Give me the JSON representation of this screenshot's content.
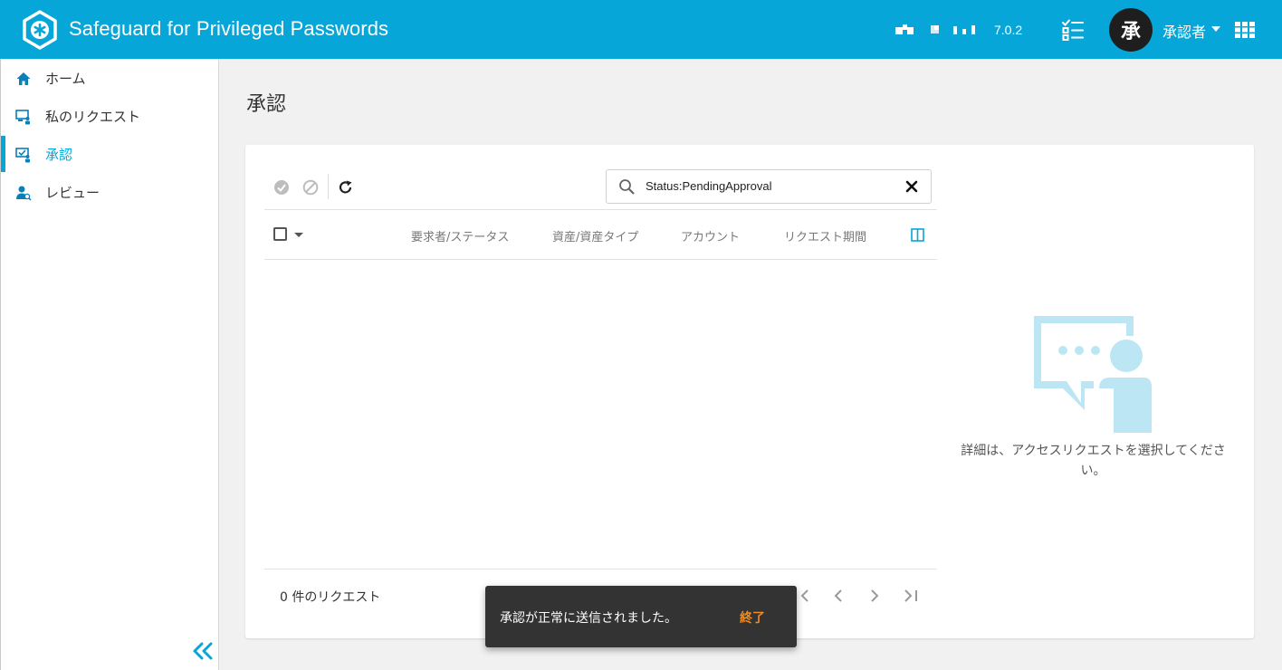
{
  "header": {
    "app_title": "Safeguard for Privileged Passwords",
    "version": "7.0.2",
    "avatar_initial": "承",
    "user_name": "承認者",
    "brand_color": "#07a6d9"
  },
  "sidebar": {
    "items": [
      {
        "label": "ホーム",
        "icon": "home-icon"
      },
      {
        "label": "私のリクエスト",
        "icon": "my-requests-icon"
      },
      {
        "label": "承認",
        "icon": "approvals-icon",
        "active": true
      },
      {
        "label": "レビュー",
        "icon": "reviews-icon"
      }
    ],
    "collapse_icon": "double-chevron-left-icon"
  },
  "main": {
    "page_title": "承認",
    "search": {
      "value": "Status:PendingApproval"
    },
    "columns": [
      "要求者/ステータス",
      "資産/資産タイプ",
      "アカウント",
      "リクエスト期間"
    ],
    "request_count": "0 件のリクエスト",
    "empty_details_text": "詳細は、アクセスリクエストを選択してください。"
  },
  "toast": {
    "message": "承認が正常に送信されました。",
    "action_label": "終了",
    "action_color": "#f28b1e"
  }
}
